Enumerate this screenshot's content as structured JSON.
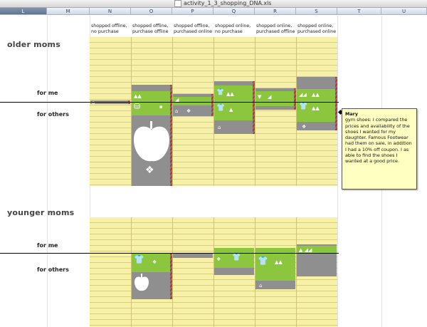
{
  "window": {
    "title": "activity_1_3_shopping_DNA.xls"
  },
  "columns": [
    {
      "letter": "L",
      "selected": true
    },
    {
      "letter": "M"
    },
    {
      "letter": "N"
    },
    {
      "letter": "O"
    },
    {
      "letter": "P"
    },
    {
      "letter": "Q"
    },
    {
      "letter": "R"
    },
    {
      "letter": "S"
    },
    {
      "letter": "T"
    },
    {
      "letter": "U"
    }
  ],
  "headers": [
    "shopped offline, no purchase",
    "shopped offline, purchase offline",
    "shopped offline, purchased online",
    "shopped online, no purchase",
    "shopped online, purchased offline",
    "shopped online, purchased online"
  ],
  "sections": {
    "older": {
      "title": "older moms",
      "for_me": "for me",
      "for_others": "for others"
    },
    "younger": {
      "title": "younger moms",
      "for_me": "for me",
      "for_others": "for others"
    }
  },
  "note": {
    "author": "Mary",
    "text": "gym shoes: I compared the prices and availability of the shoes I wanted for my daughter. Famous Footwear had them on sale, in addition I had a 10% off coupon. I as able to find the shoes I wanted at a good price."
  },
  "colors": {
    "green": "#8cc63f",
    "gray": "#8f8f8f",
    "yellow": "#f7f0a8",
    "red": "#d8262c"
  },
  "icons": [
    "shoe-icon",
    "tshirt-icon",
    "bag-icon",
    "house-icon",
    "apple-icon",
    "gift-icon"
  ]
}
